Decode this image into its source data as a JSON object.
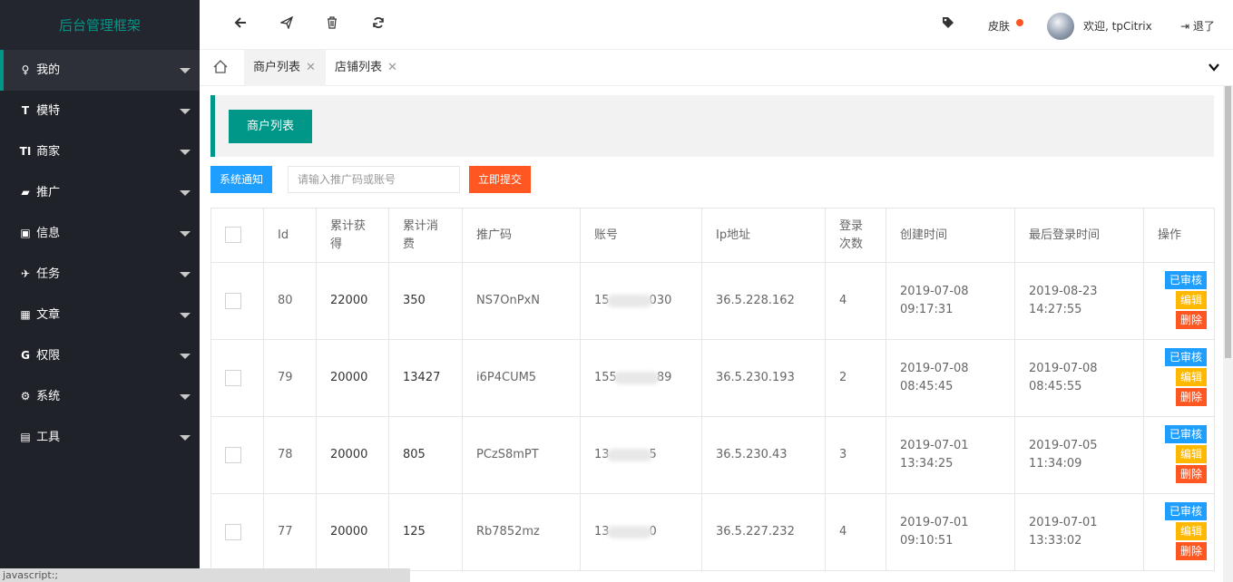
{
  "app": {
    "title": "后台管理框架"
  },
  "sidebar": {
    "items": [
      {
        "icon": "user-icon",
        "glyph": "♀",
        "label": "我的"
      },
      {
        "icon": "text-icon",
        "glyph": "T",
        "label": "模特"
      },
      {
        "icon": "text-height-icon",
        "glyph": "TI",
        "label": "商家"
      },
      {
        "icon": "book-icon",
        "glyph": "▰",
        "label": "推广"
      },
      {
        "icon": "briefcase-icon",
        "glyph": "▣",
        "label": "信息"
      },
      {
        "icon": "plane-icon",
        "glyph": "✈",
        "label": "任务"
      },
      {
        "icon": "grid-icon",
        "glyph": "▦",
        "label": "文章"
      },
      {
        "icon": "google-icon",
        "glyph": "G",
        "label": "权限"
      },
      {
        "icon": "gear-icon",
        "glyph": "⚙",
        "label": "系统"
      },
      {
        "icon": "toolbox-icon",
        "glyph": "▤",
        "label": "工具"
      }
    ]
  },
  "header": {
    "skin_label": "皮肤",
    "welcome": "欢迎, tpCitrix",
    "logout": "退了",
    "logout_glyph": "⇥"
  },
  "tabs": [
    {
      "label": "商户列表"
    },
    {
      "label": "店铺列表"
    }
  ],
  "page": {
    "title_button": "商户列表",
    "notice_button": "系统通知",
    "search_placeholder": "请输入推广码或账号",
    "submit_button": "立即提交"
  },
  "table": {
    "headers": {
      "id": "Id",
      "earned": "累计获得",
      "spent": "累计消费",
      "promo": "推广码",
      "account": "账号",
      "ip": "Ip地址",
      "logins": "登录次数",
      "created": "创建时间",
      "last_login": "最后登录时间",
      "ops": "操作"
    },
    "ops": {
      "approve": "已审核",
      "edit": "编辑",
      "delete": "删除"
    },
    "rows": [
      {
        "id": "80",
        "earned": "22000",
        "spent": "350",
        "promo": "NS7OnPxN",
        "acc_pre": "15",
        "acc_suf": "030",
        "ip": "36.5.228.162",
        "logins": "4",
        "created_date": "2019-07-08",
        "created_time": "09:17:31",
        "last_date": "2019-08-23",
        "last_time": "14:27:55"
      },
      {
        "id": "79",
        "earned": "20000",
        "spent": "13427",
        "promo": "i6P4CUM5",
        "acc_pre": "155",
        "acc_suf": "89",
        "ip": "36.5.230.193",
        "logins": "2",
        "created_date": "2019-07-08",
        "created_time": "08:45:45",
        "last_date": "2019-07-08",
        "last_time": "08:45:55"
      },
      {
        "id": "78",
        "earned": "20000",
        "spent": "805",
        "promo": "PCzS8mPT",
        "acc_pre": "13",
        "acc_suf": "5",
        "ip": "36.5.230.43",
        "logins": "3",
        "created_date": "2019-07-01",
        "created_time": "13:34:25",
        "last_date": "2019-07-05",
        "last_time": "11:34:09"
      },
      {
        "id": "77",
        "earned": "20000",
        "spent": "125",
        "promo": "Rb7852mz",
        "acc_pre": "13",
        "acc_suf": "0",
        "ip": "36.5.227.232",
        "logins": "4",
        "created_date": "2019-07-01",
        "created_time": "09:10:51",
        "last_date": "2019-07-01",
        "last_time": "13:33:02"
      }
    ]
  },
  "statusbar": {
    "text": "javascript:;"
  },
  "colors": {
    "accent": "#009688",
    "blue": "#1e9fff",
    "orange": "#ff5722",
    "yellow": "#ffb800",
    "sidebar": "#20222a"
  }
}
